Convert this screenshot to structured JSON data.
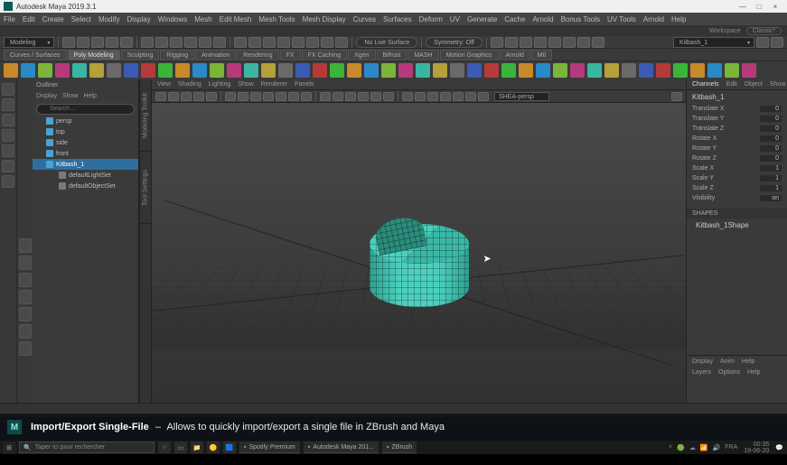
{
  "titlebar": {
    "title": "Autodesk Maya 2019.3.1"
  },
  "menubar": [
    "File",
    "Edit",
    "Create",
    "Select",
    "Modify",
    "Display",
    "Windows",
    "Mesh",
    "Edit Mesh",
    "Mesh Tools",
    "Mesh Display",
    "Curves",
    "Surfaces",
    "Deform",
    "UV",
    "Generate",
    "Cache",
    "Arnold",
    "Bonus Tools",
    "UV Tools",
    "Arnold",
    "Help"
  ],
  "statusline": {
    "workspace_label": "Workspace",
    "workspace_value": "Classic*"
  },
  "shelf": {
    "modeling_dropdown": "Modeling",
    "symmetry": "Symmetry: Off",
    "no_live_surface": "No Live Surface",
    "search_field": "Kitbash_1",
    "tabs": [
      "Curves / Surfaces",
      "Poly Modeling",
      "Sculpting",
      "Rigging",
      "Animation",
      "Rendering",
      "FX",
      "FX Caching",
      "Xgen",
      "Bifrost",
      "MASH",
      "Motion Graphics",
      "Arnold",
      "Mtl"
    ]
  },
  "outliner": {
    "title": "Outliner",
    "menus": [
      "Display",
      "Show",
      "Help"
    ],
    "search_placeholder": "Search...",
    "items": [
      {
        "label": "persp",
        "type": "cam"
      },
      {
        "label": "top",
        "type": "cam"
      },
      {
        "label": "side",
        "type": "cam"
      },
      {
        "label": "front",
        "type": "cam"
      },
      {
        "label": "Kitbash_1",
        "type": "mesh",
        "selected": true
      },
      {
        "label": "defaultLightSet",
        "type": "set",
        "child": true
      },
      {
        "label": "defaultObjectSet",
        "type": "set",
        "child": true
      }
    ]
  },
  "vtabs": [
    "Modeling Toolkit",
    "Tool Settings"
  ],
  "viewport": {
    "menus": [
      "View",
      "Shading",
      "Lighting",
      "Show",
      "Renderer",
      "Panels"
    ],
    "camera": "SHEA-persp"
  },
  "channelbox": {
    "tabs": [
      "Channels",
      "Edit",
      "Object",
      "Show"
    ],
    "active_tab": "Channels",
    "object": "Kitbash_1",
    "attrs": [
      {
        "name": "Translate X",
        "value": "0"
      },
      {
        "name": "Translate Y",
        "value": "0"
      },
      {
        "name": "Translate Z",
        "value": "0"
      },
      {
        "name": "Rotate X",
        "value": "0"
      },
      {
        "name": "Rotate Y",
        "value": "0"
      },
      {
        "name": "Rotate Z",
        "value": "0"
      },
      {
        "name": "Scale X",
        "value": "1"
      },
      {
        "name": "Scale Y",
        "value": "1"
      },
      {
        "name": "Scale Z",
        "value": "1"
      },
      {
        "name": "Visibility",
        "value": "on"
      }
    ],
    "shapes_header": "SHAPES",
    "shape_name": "Kitbash_1Shape",
    "bottom_tabs": [
      "Display",
      "Anim",
      "Help"
    ],
    "bottom_tabs2": [
      "Layers",
      "Options",
      "Help"
    ]
  },
  "caption": {
    "icon": "M",
    "title": "Import/Export Single-File",
    "desc": "Allows to quickly import/export a single file in ZBrush and Maya"
  },
  "taskbar": {
    "search_placeholder": "Taper ici pour rechercher",
    "apps": [
      {
        "label": "Spotify Premium"
      },
      {
        "label": "Autodesk Maya 201..."
      },
      {
        "label": "ZBrush"
      }
    ],
    "lang": "FRA",
    "time": "00:35",
    "date": "19-06-20"
  }
}
